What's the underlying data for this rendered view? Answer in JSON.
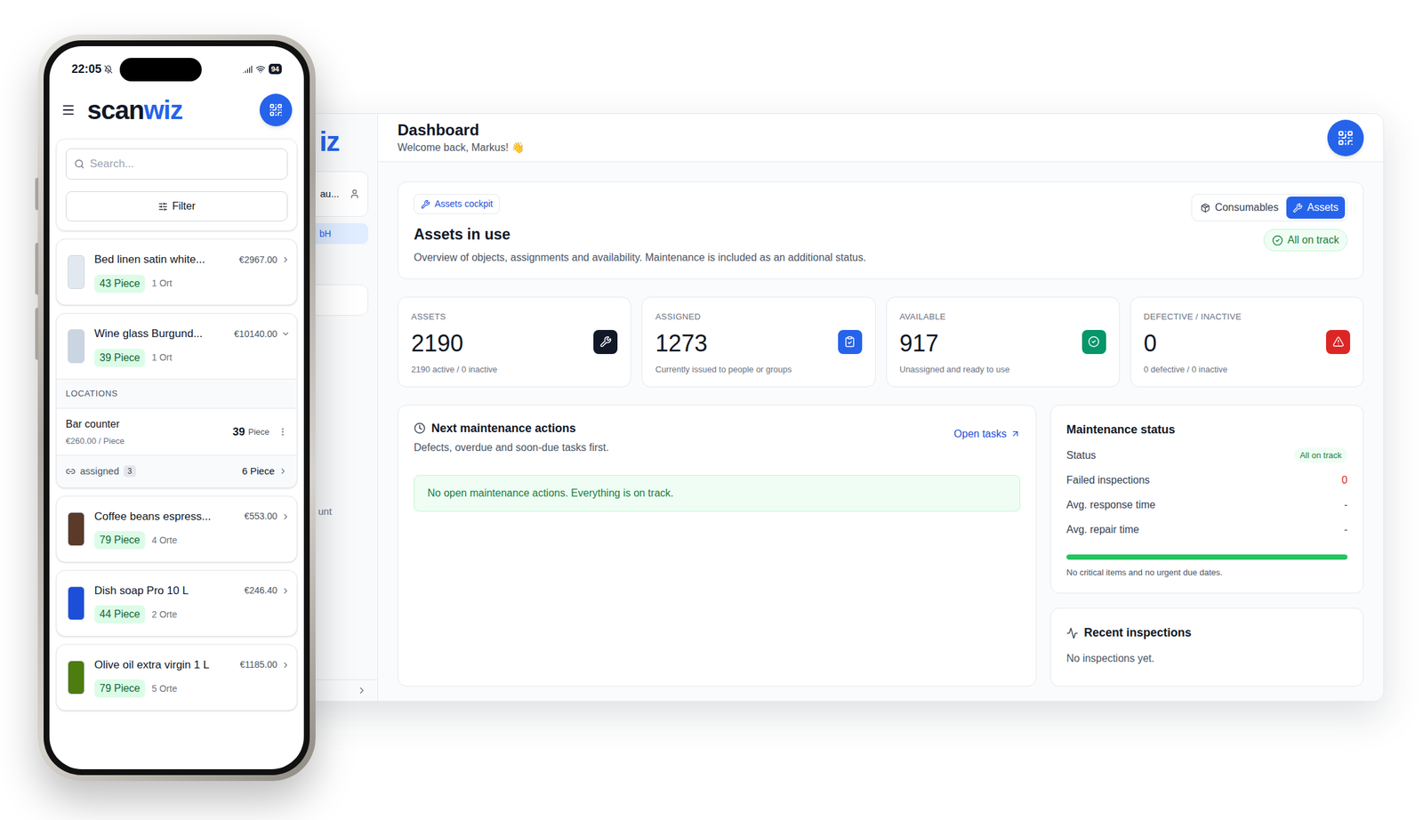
{
  "phone": {
    "status_bar": {
      "time": "22:05",
      "battery": "94"
    },
    "logo": {
      "dark": "scan",
      "blue": "wiz"
    },
    "search": {
      "placeholder": "Search..."
    },
    "filter_button": "Filter",
    "items": [
      {
        "name": "Bed linen satin white...",
        "price": "€2967.00",
        "quantity": "43 Piece",
        "places": "1 Ort",
        "expanded": false,
        "color": "#e2e8f0"
      },
      {
        "name": "Wine glass Burgund...",
        "price": "€10140.00",
        "quantity": "39 Piece",
        "places": "1 Ort",
        "expanded": true,
        "color": "#cbd5e1",
        "locations": {
          "heading": "LOCATIONS",
          "rows": [
            {
              "name": "Bar counter",
              "unit_price": "€260.00 / Piece",
              "count": "39",
              "unit": "Piece"
            }
          ],
          "assigned": {
            "label": "assigned",
            "count": "3",
            "quantity": "6 Piece"
          }
        }
      },
      {
        "name": "Coffee beans espress...",
        "price": "€553.00",
        "quantity": "79 Piece",
        "places": "4 Orte",
        "expanded": false,
        "color": "#5b3a29"
      },
      {
        "name": "Dish soap Pro 10 L",
        "price": "€246.40",
        "quantity": "44 Piece",
        "places": "2 Orte",
        "expanded": false,
        "color": "#1d4ed8"
      },
      {
        "name": "Olive oil extra virgin 1 L",
        "price": "€1185.00",
        "quantity": "79 Piece",
        "places": "5 Orte",
        "expanded": false,
        "color": "#4d7c0f"
      }
    ]
  },
  "dashboard": {
    "sidebar": {
      "logo_fragment": "iz",
      "user_fragment": "au...",
      "items": [
        {
          "label": "bH",
          "selected": true
        },
        {
          "label": "unt",
          "selected": false
        }
      ]
    },
    "header": {
      "title": "Dashboard",
      "subtitle": "Welcome back, Markus! 👋"
    },
    "cockpit": {
      "badge": "Assets cockpit",
      "title": "Assets in use",
      "description": "Overview of objects, assignments and availability. Maintenance is included as an additional status.",
      "toggle": [
        {
          "label": "Consumables",
          "selected": false
        },
        {
          "label": "Assets",
          "selected": true
        }
      ],
      "status": "All on track"
    },
    "stats": [
      {
        "label": "ASSETS",
        "value": "2190",
        "sub": "2190 active / 0 inactive",
        "color": "#111827"
      },
      {
        "label": "ASSIGNED",
        "value": "1273",
        "sub": "Currently issued to people or groups",
        "color": "#2563eb"
      },
      {
        "label": "AVAILABLE",
        "value": "917",
        "sub": "Unassigned and ready to use",
        "color": "#059669"
      },
      {
        "label": "DEFECTIVE / INACTIVE",
        "value": "0",
        "sub": "0 defective / 0 inactive",
        "color": "#dc2626"
      }
    ],
    "next_actions": {
      "title": "Next maintenance actions",
      "subtitle": "Defects, overdue and soon-due tasks first.",
      "link": "Open tasks",
      "empty": "No open maintenance actions. Everything is on track."
    },
    "maintenance_status": {
      "title": "Maintenance status",
      "rows": [
        {
          "label": "Status",
          "value": "All on track",
          "kind": "badge"
        },
        {
          "label": "Failed inspections",
          "value": "0",
          "kind": "danger"
        },
        {
          "label": "Avg. response time",
          "value": "-",
          "kind": "plain"
        },
        {
          "label": "Avg. repair time",
          "value": "-",
          "kind": "plain"
        }
      ],
      "level": 1,
      "caption": "No critical items and no urgent due dates."
    },
    "recent_inspections": {
      "title": "Recent inspections",
      "empty": "No inspections yet."
    }
  }
}
